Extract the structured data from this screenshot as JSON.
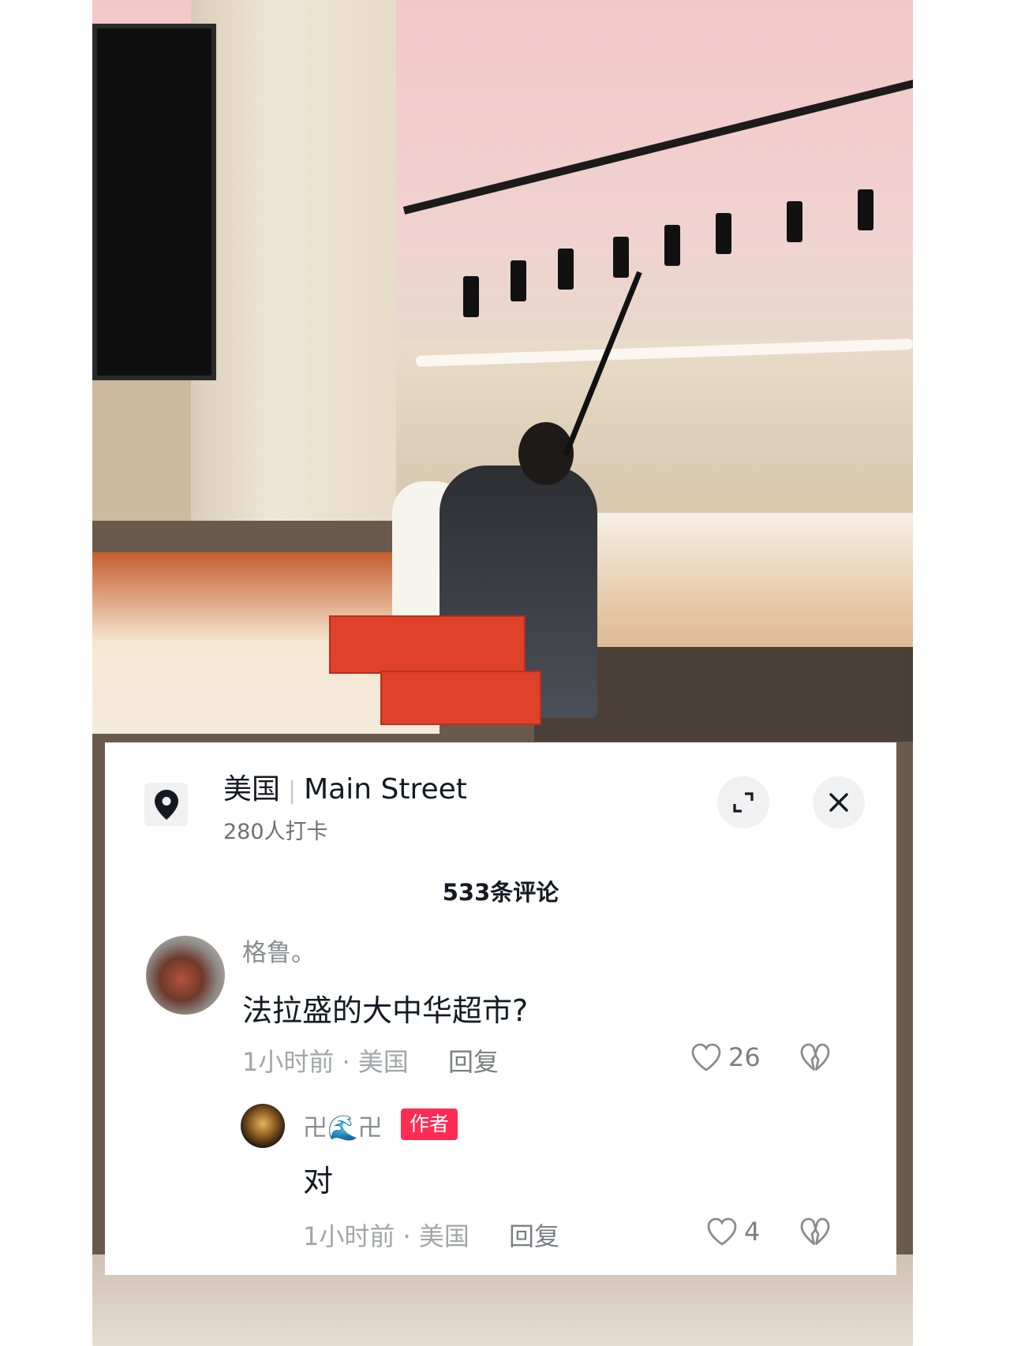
{
  "location": {
    "country": "美国",
    "place": "Main Street",
    "checkins": "280人打卡"
  },
  "comments_header": {
    "count_label": "533条评论"
  },
  "comments": [
    {
      "username": "格鲁。",
      "text": "法拉盛的大中华超市?",
      "time_location": "1小时前 · 美国",
      "reply_label": "回复",
      "likes": "26"
    }
  ],
  "replies": [
    {
      "username": "卍🌊卍",
      "badge": "作者",
      "text": "对",
      "time_location": "1小时前 · 美国",
      "reply_label": "回复",
      "likes": "4"
    }
  ],
  "icons": {
    "location": "location-pin-icon",
    "expand": "expand-icon",
    "close": "close-icon",
    "like": "heart-outline-icon",
    "dislike": "broken-heart-icon"
  },
  "colors": {
    "author_badge": "#fe2c55",
    "primary_text": "#161823",
    "secondary_text": "#8a8b91"
  }
}
